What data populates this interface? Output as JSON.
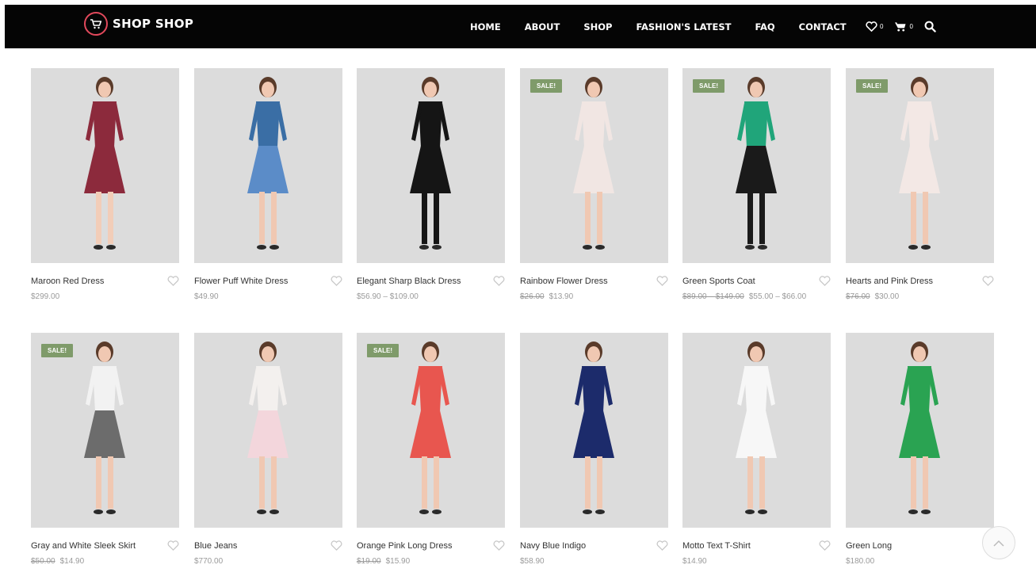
{
  "header": {
    "logo_text": "SHOP SHOP",
    "nav": [
      "HOME",
      "ABOUT",
      "SHOP",
      "FASHION'S LATEST",
      "FAQ",
      "CONTACT"
    ],
    "wishlist_count": "0",
    "cart_count": "0"
  },
  "colors": {
    "navbar_bg": "#050505",
    "logo_accent": "#e2495c",
    "sale_badge": "#7f9b6a",
    "image_bg": "#dcdcdc"
  },
  "sale_label": "SALE!",
  "products": [
    {
      "name": "Maroon Red Dress",
      "price": "$299.00",
      "old_price": "",
      "sale": false,
      "dress": "#8c2a3c",
      "top": "#8c2a3c",
      "legs": "#f2cdb8"
    },
    {
      "name": "Flower Puff White Dress",
      "price": "$49.90",
      "old_price": "",
      "sale": false,
      "dress": "#5b8cc8",
      "top": "#3a6ea5",
      "legs": "#f0c8b2"
    },
    {
      "name": "Elegant Sharp Black Dress",
      "price": "$56.90 – $109.00",
      "old_price": "",
      "sale": false,
      "dress": "#151515",
      "top": "#151515",
      "legs": "#151515"
    },
    {
      "name": "Rainbow Flower Dress",
      "price": "$13.90",
      "old_price": "$26.00",
      "sale": true,
      "dress": "#f1e6e3",
      "top": "#f1e6e3",
      "legs": "#f0c8b2"
    },
    {
      "name": "Green Sports Coat",
      "price": "$55.00 – $66.00",
      "old_price": "$89.00 – $149.00",
      "sale": true,
      "dress": "#1a1a1a",
      "top": "#20a57a",
      "legs": "#1a1a1a"
    },
    {
      "name": "Hearts and Pink Dress",
      "price": "$30.00",
      "old_price": "$76.00",
      "sale": true,
      "dress": "#f3e8e5",
      "top": "#f3e8e5",
      "legs": "#f0c8b2"
    },
    {
      "name": "Gray and White Sleek Skirt",
      "price": "$14.90",
      "old_price": "$50.00",
      "sale": true,
      "dress": "#6c6c6c",
      "top": "#f2f2f2",
      "legs": "#f0c8b2"
    },
    {
      "name": "Blue Jeans",
      "price": "$770.00",
      "old_price": "",
      "sale": false,
      "dress": "#f3d6dc",
      "top": "#f3f0ee",
      "legs": "#f0c8b2"
    },
    {
      "name": "Orange Pink Long Dress",
      "price": "$15.90",
      "old_price": "$19.00",
      "sale": true,
      "dress": "#e8564f",
      "top": "#e8564f",
      "legs": "#f0c8b2"
    },
    {
      "name": "Navy Blue Indigo",
      "price": "$58.90",
      "old_price": "",
      "sale": false,
      "dress": "#1c2b6b",
      "top": "#1c2b6b",
      "legs": "#f0c8b2"
    },
    {
      "name": "Motto Text T-Shirt",
      "price": "$14.90",
      "old_price": "",
      "sale": false,
      "dress": "#f7f7f7",
      "top": "#f7f7f7",
      "legs": "#f0c8b2"
    },
    {
      "name": "Green Long",
      "price": "$180.00",
      "old_price": "",
      "sale": false,
      "dress": "#2aa352",
      "top": "#2aa352",
      "legs": "#f0c8b2"
    }
  ]
}
